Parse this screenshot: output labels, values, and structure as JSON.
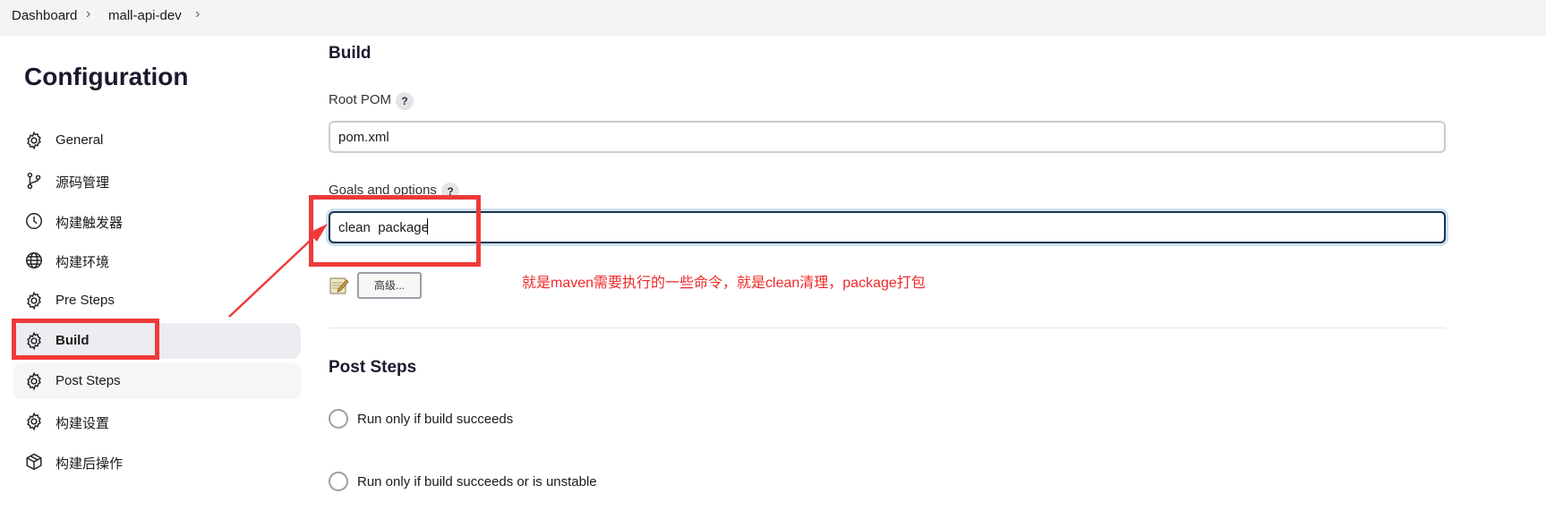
{
  "breadcrumb": {
    "items": [
      "Dashboard",
      "mall-api-dev"
    ],
    "separator": ">"
  },
  "sidebar": {
    "title": "Configuration",
    "items": [
      {
        "label": "General",
        "icon": "gear-icon"
      },
      {
        "label": "源码管理",
        "icon": "git-branch-icon"
      },
      {
        "label": "构建触发器",
        "icon": "clock-icon"
      },
      {
        "label": "构建环境",
        "icon": "globe-icon"
      },
      {
        "label": "Pre Steps",
        "icon": "gear-icon"
      },
      {
        "label": "Build",
        "icon": "gear-icon",
        "active": true
      },
      {
        "label": "Post Steps",
        "icon": "gear-icon"
      },
      {
        "label": "构建设置",
        "icon": "gear-icon"
      },
      {
        "label": "构建后操作",
        "icon": "package-icon"
      }
    ]
  },
  "build": {
    "title": "Build",
    "root_pom": {
      "label": "Root POM",
      "help": "?",
      "value": "pom.xml"
    },
    "goals": {
      "label": "Goals and options",
      "help": "?",
      "value": "clean  package"
    },
    "advanced_button": "高级..."
  },
  "post_steps": {
    "title": "Post Steps",
    "options": [
      "Run only if build succeeds",
      "Run only if build succeeds or is unstable"
    ]
  },
  "annotation": {
    "text": "就是maven需要执行的一些命令，就是clean清理，package打包",
    "color": "#ee2a2a"
  },
  "colors": {
    "accent_border": "#1a3550",
    "active_item_bg": "#ececf1",
    "highlight_red": "#ee3a3a"
  }
}
